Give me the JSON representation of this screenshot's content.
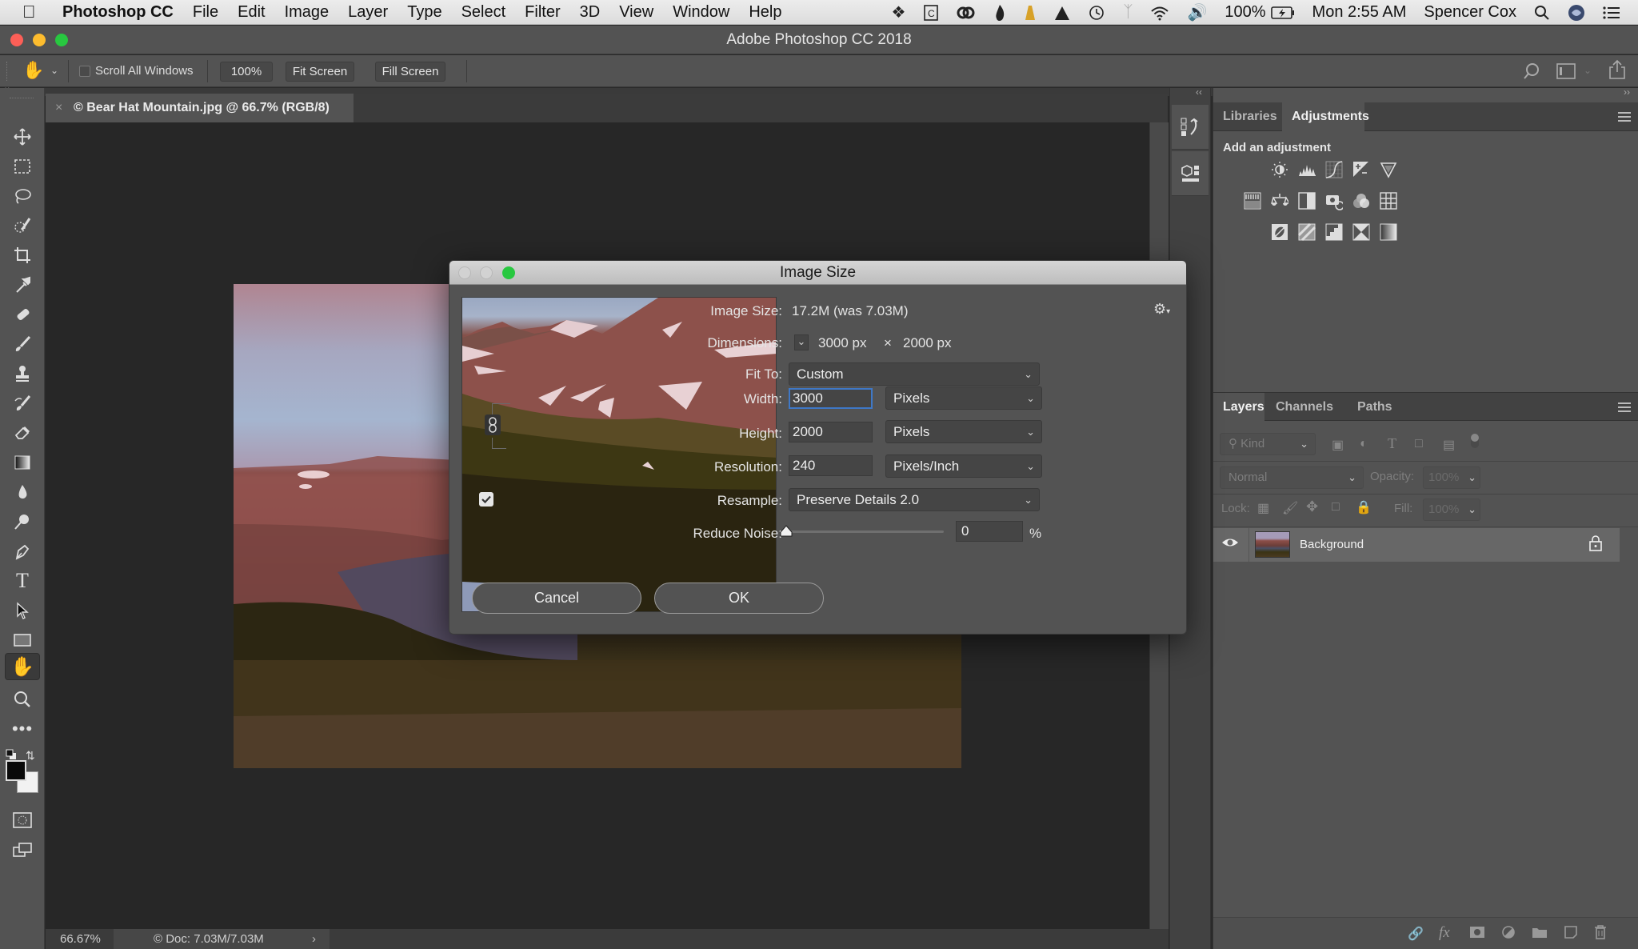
{
  "menubar": {
    "app_name": "Photoshop CC",
    "items": [
      "File",
      "Edit",
      "Image",
      "Layer",
      "Type",
      "Select",
      "Filter",
      "3D",
      "View",
      "Window",
      "Help"
    ],
    "status_icons": [
      "dropbox-icon",
      "clipboard-icon",
      "creative-cloud-icon",
      "flame-icon",
      "cone-icon",
      "triangle-icon",
      "time-machine-icon",
      "bluetooth-icon",
      "wifi-icon",
      "volume-icon"
    ],
    "battery": "100%",
    "clock": "Mon 2:55 AM",
    "user": "Spencer Cox"
  },
  "window": {
    "title": "Adobe Photoshop CC 2018"
  },
  "options_bar": {
    "scroll_all_windows_label": "Scroll All Windows",
    "scroll_all_windows_checked": false,
    "zoom_100": "100%",
    "fit_screen": "Fit Screen",
    "fill_screen": "Fill Screen"
  },
  "document": {
    "tab_title": "© Bear Hat Mountain.jpg @ 66.7% (RGB/8)",
    "zoom_level": "66.67%",
    "doc_info": "© Doc: 7.03M/7.03M"
  },
  "tools": [
    "move",
    "marquee",
    "lasso",
    "quick-selection",
    "crop",
    "eyedropper",
    "healing-brush",
    "brush",
    "clone-stamp",
    "history-brush",
    "eraser",
    "gradient",
    "blur",
    "dodge",
    "pen",
    "type",
    "path-selection",
    "rectangle",
    "hand",
    "zoom",
    "more-tools"
  ],
  "active_tool": "hand",
  "dialog": {
    "title": "Image Size",
    "image_size_label": "Image Size:",
    "image_size_value": "17.2M (was 7.03M)",
    "dimensions_label": "Dimensions:",
    "dimensions_width": "3000 px",
    "dimensions_times": "×",
    "dimensions_height": "2000 px",
    "fit_to_label": "Fit To:",
    "fit_to_value": "Custom",
    "width_label": "Width:",
    "width_value": "3000",
    "width_unit": "Pixels",
    "height_label": "Height:",
    "height_value": "2000",
    "height_unit": "Pixels",
    "resolution_label": "Resolution:",
    "resolution_value": "240",
    "resolution_unit": "Pixels/Inch",
    "resample_label": "Resample:",
    "resample_checked": true,
    "resample_value": "Preserve Details 2.0",
    "reduce_noise_label": "Reduce Noise:",
    "reduce_noise_value": "0",
    "reduce_noise_percent": 0,
    "percent_sign": "%",
    "cancel": "Cancel",
    "ok": "OK"
  },
  "panels": {
    "top_tabs": [
      "Libraries",
      "Adjustments"
    ],
    "top_active": "Adjustments",
    "adjustments_heading": "Add an adjustment",
    "adjustment_rows": [
      [
        "brightness-contrast",
        "levels",
        "curves",
        "exposure",
        "vibrance"
      ],
      [
        "hue-saturation",
        "color-balance",
        "black-white",
        "photo-filter",
        "channel-mixer",
        "color-lookup"
      ],
      [
        "invert",
        "posterize",
        "threshold",
        "selective-color",
        "gradient-map"
      ]
    ],
    "layer_tabs": [
      "Layers",
      "Channels",
      "Paths"
    ],
    "layer_active": "Layers",
    "filter_kind": "Kind",
    "blend_mode": "Normal",
    "opacity_label": "Opacity:",
    "opacity_value": "100%",
    "lock_label": "Lock:",
    "fill_label": "Fill:",
    "fill_value": "100%",
    "layers": [
      {
        "name": "Background",
        "visible": true,
        "locked": true
      }
    ],
    "footer_icons": [
      "link-icon",
      "fx-icon",
      "mask-icon",
      "adjustment-layer-icon",
      "group-folder-icon",
      "new-layer-icon",
      "trash-icon"
    ]
  },
  "colors": {
    "accent_focus": "#3f78c6",
    "close": "#fc5f57",
    "minimize": "#fdbc2e",
    "zoom": "#28c840",
    "foreground": "#0a0a0a",
    "background": "#f2f2f2"
  }
}
